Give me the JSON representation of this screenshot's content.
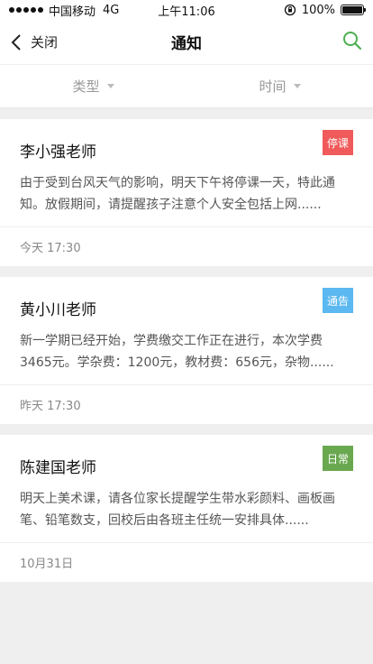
{
  "status_bar": {
    "carrier": "中国移动",
    "network": "4G",
    "time": "上午11:06",
    "battery": "100%",
    "battery_level": 1.0,
    "signal_dots": 5
  },
  "nav": {
    "back_label": "关闭",
    "title": "通知"
  },
  "filters": [
    {
      "label": "类型"
    },
    {
      "label": "时间"
    }
  ],
  "notices": [
    {
      "teacher": "李小强老师",
      "tag": "停课",
      "tag_color": "#f05a5a",
      "content": "由于受到台风天气的影响，明天下午将停课一天，特此通知。放假期间，请提醒孩子注意个人安全包括上网......",
      "time": "今天 17:30"
    },
    {
      "teacher": "黄小川老师",
      "tag": "通告",
      "tag_color": "#5bb8f0",
      "content": "新一学期已经开始，学费缴交工作正在进行，本次学费3465元。学杂费：1200元，教材费：656元，杂物......",
      "time": "昨天 17:30"
    },
    {
      "teacher": "陈建国老师",
      "tag": "日常",
      "tag_color": "#6aa84f",
      "content": "明天上美术课，请各位家长提醒学生带水彩颜料、画板画笔、铅笔数支，回校后由各班主任统一安排具体......",
      "time": "10月31日"
    }
  ],
  "colors": {
    "accent": "#4caf50"
  },
  "icons": {
    "back": "chevron-left-icon",
    "search": "search-icon",
    "lock": "rotation-lock-icon"
  }
}
